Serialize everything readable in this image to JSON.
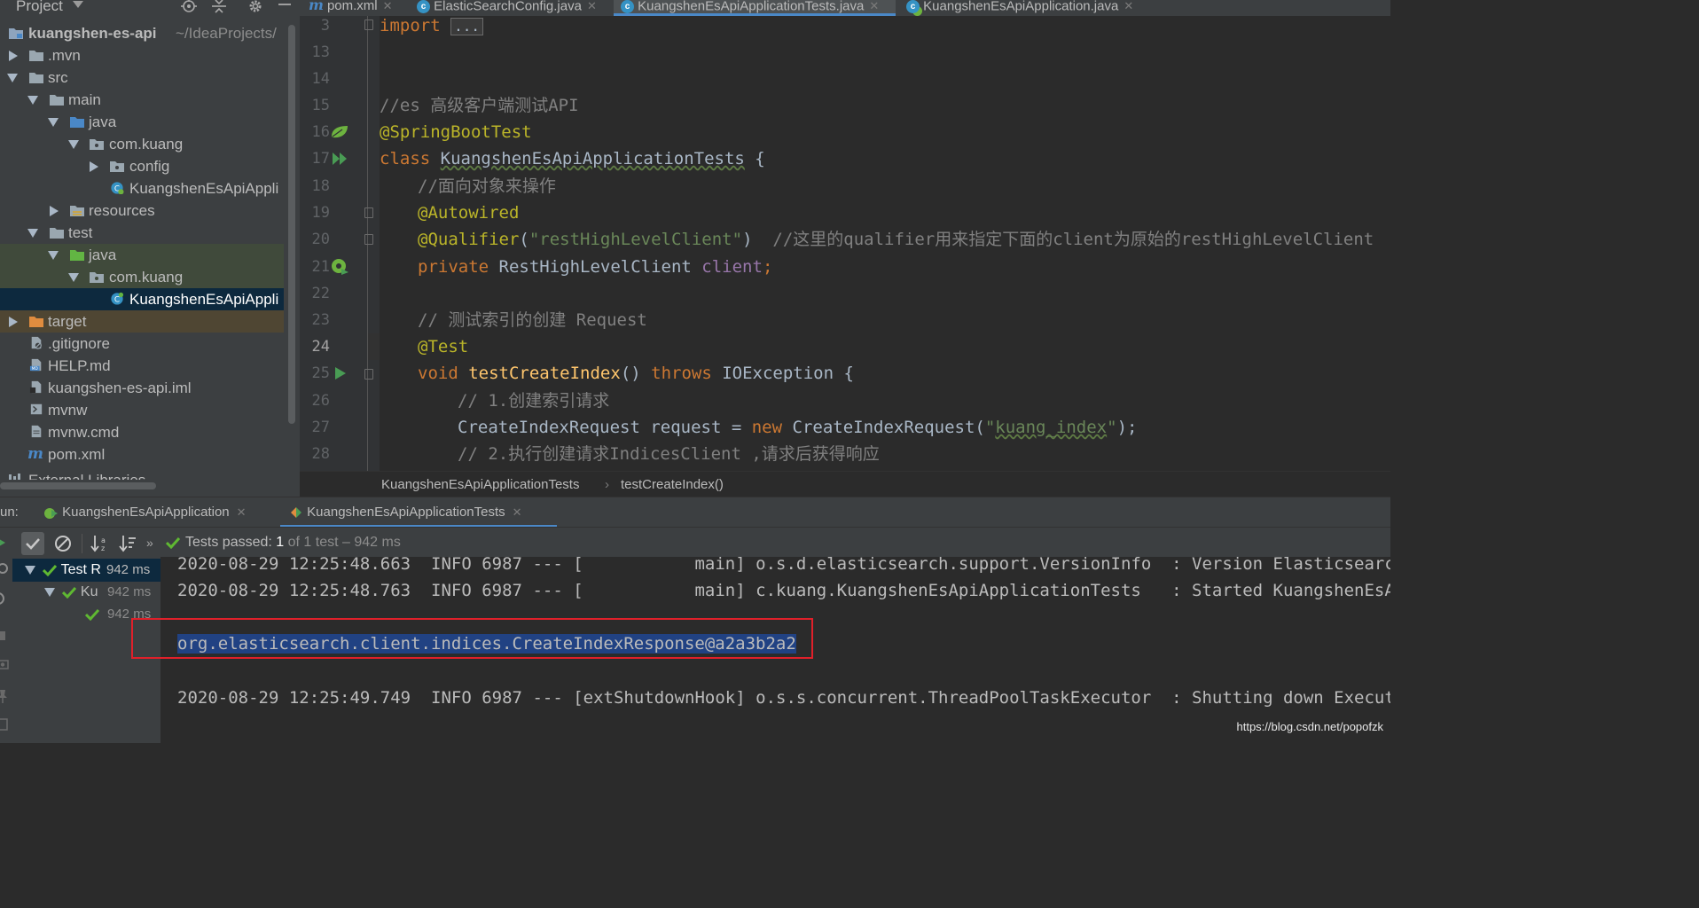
{
  "project_panel": {
    "title": "Project",
    "tree": [
      {
        "label": "kuangshen-es-api",
        "hint": "~/IdeaProjects/",
        "icon": "module-folder-icon"
      },
      {
        "label": ".mvn",
        "icon": "folder-icon"
      },
      {
        "label": "src",
        "icon": "folder-icon"
      },
      {
        "label": "main",
        "icon": "folder-icon"
      },
      {
        "label": "java",
        "icon": "source-folder-icon"
      },
      {
        "label": "com.kuang",
        "icon": "package-icon"
      },
      {
        "label": "config",
        "icon": "package-icon"
      },
      {
        "label": "KuangshenEsApiAppli",
        "icon": "spring-boot-class-icon"
      },
      {
        "label": "resources",
        "icon": "resources-folder-icon"
      },
      {
        "label": "test",
        "icon": "folder-icon"
      },
      {
        "label": "java",
        "icon": "test-source-folder-icon"
      },
      {
        "label": "com.kuang",
        "icon": "package-icon"
      },
      {
        "label": "KuangshenEsApiAppli",
        "icon": "test-class-icon"
      },
      {
        "label": "target",
        "icon": "excluded-folder-icon"
      },
      {
        "label": ".gitignore",
        "icon": "gitignore-file-icon"
      },
      {
        "label": "HELP.md",
        "icon": "markdown-file-icon"
      },
      {
        "label": "kuangshen-es-api.iml",
        "icon": "iml-file-icon"
      },
      {
        "label": "mvnw",
        "icon": "shell-file-icon"
      },
      {
        "label": "mvnw.cmd",
        "icon": "text-file-icon"
      },
      {
        "label": "pom.xml",
        "icon": "maven-icon"
      },
      {
        "label": "External Libraries",
        "icon": "libraries-icon"
      }
    ]
  },
  "editor_tabs": [
    {
      "label": "pom.xml",
      "icon": "maven-icon"
    },
    {
      "label": "ElasticSearchConfig.java",
      "icon": "class-icon"
    },
    {
      "label": "KuangshenEsApiApplicationTests.java",
      "icon": "test-class-icon",
      "active": true
    },
    {
      "label": "KuangshenEsApiApplication.java",
      "icon": "spring-boot-class-icon"
    }
  ],
  "editor": {
    "line_numbers": [
      "3",
      "13",
      "14",
      "15",
      "16",
      "17",
      "18",
      "19",
      "20",
      "21",
      "22",
      "23",
      "24",
      "25",
      "26",
      "27",
      "28"
    ],
    "current_line": "24",
    "code": {
      "l3_import": "import",
      "l3_fold": "...",
      "l15_comment": "//es 高级客户端测试API",
      "l16_annotation": "@SpringBootTest",
      "l17_kw": "class",
      "l17_name": "KuangshenEsApiApplicationTests",
      "l17_rest": " {",
      "l18_comment": "//面向对象来操作",
      "l19_annotation": "@Autowired",
      "l20_annotation": "@Qualifier",
      "l20_paren_open": "(",
      "l20_string": "\"restHighLevelClient\"",
      "l20_paren_close": ")",
      "l20_comment": "//这里的qualifier用来指定下面的client为原始的restHighLevelClient",
      "l21_kw": "private",
      "l21_type": " RestHighLevelClient ",
      "l21_field": "client",
      "l21_semi": ";",
      "l23_comment": "// 测试索引的创建 Request",
      "l24_annotation": "@Test",
      "l25_kw": "void",
      "l25_method": "testCreateIndex",
      "l25_parens": "() ",
      "l25_throws": "throws",
      "l25_rest": " IOException {",
      "l26_comment": "// 1.创建索引请求",
      "l27_start": "CreateIndexRequest request = ",
      "l27_new": "new",
      "l27_mid": " CreateIndexRequest(",
      "l27_q1": "\"",
      "l27_str": "kuang_index",
      "l27_q2": "\"",
      "l27_end": ");",
      "l28_comment": "// 2.执行创建请求IndicesClient ,请求后获得响应"
    }
  },
  "breadcrumb": {
    "class_name": "KuangshenEsApiApplicationTests",
    "separator": "›",
    "method_name": "testCreateIndex()"
  },
  "run": {
    "label": "un:",
    "tabs": [
      {
        "label": "KuangshenEsApiApplication",
        "icon": "spring-boot-run-icon"
      },
      {
        "label": "KuangshenEsApiApplicationTests",
        "icon": "test-run-icon",
        "active": true
      }
    ],
    "status_prefix": "Tests passed: ",
    "status_count": "1",
    "status_suffix": " of 1 test – 942 ms",
    "test_tree": [
      {
        "label": "Test R",
        "time": "942 ms"
      },
      {
        "label": "Ku",
        "time": "942 ms"
      },
      {
        "label": "",
        "time": "942 ms"
      }
    ],
    "console": [
      {
        "date": "2020-08-29 12:25:48.663",
        "level": "INFO",
        "pid": "6987",
        "sep": "---",
        "thread": "[           main]",
        "logger": "o.s.d.elasticsearch.support.VersionInfo",
        "msg": ": Version Elasticsearch"
      },
      {
        "date": "2020-08-29 12:25:48.763",
        "level": "INFO",
        "pid": "6987",
        "sep": "---",
        "thread": "[           main]",
        "logger": "c.kuang.KuangshenEsApiApplicationTests",
        "msg": ": Started KuangshenEsAp"
      },
      {
        "output": "org.elasticsearch.client.indices.CreateIndexResponse@a2a3b2a2"
      },
      {
        "date": "2020-08-29 12:25:49.749",
        "level": "INFO",
        "pid": "6987",
        "sep": "---",
        "thread": "[extShutdownHook]",
        "logger": "o.s.s.concurrent.ThreadPoolTaskExecutor",
        "msg": ": Shutting down Execut"
      }
    ]
  },
  "watermark": "https://blog.csdn.net/popofzk",
  "colors": {
    "keyword": "#cc7832",
    "annotation": "#bbb529",
    "string": "#6a8759",
    "comment": "#808080",
    "field": "#9876aa",
    "method": "#ffc66d",
    "selection": "#214283",
    "highlight_box": "#e0202a",
    "pass_green": "#5fb832"
  }
}
